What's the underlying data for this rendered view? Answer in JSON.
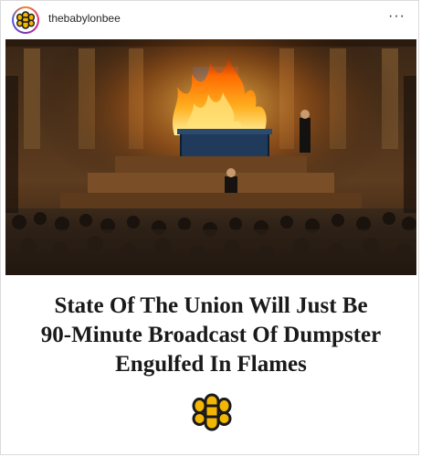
{
  "header": {
    "username": "thebabylonbee",
    "more_label": "···"
  },
  "post": {
    "headline_lines": [
      "State Of The Union Will Just Be",
      "90-Minute Broadcast Of Dumpster",
      "Engulfed In Flames"
    ],
    "image_icon": "house-chamber-burning-dumpster",
    "logo_icon": "babylon-bee-logo-icon"
  },
  "colors": {
    "logo_yellow": "#f2b705",
    "logo_outline": "#1a1a1a",
    "fire_orange": "#ff8a00",
    "chamber_brown": "#5a3a1e"
  }
}
